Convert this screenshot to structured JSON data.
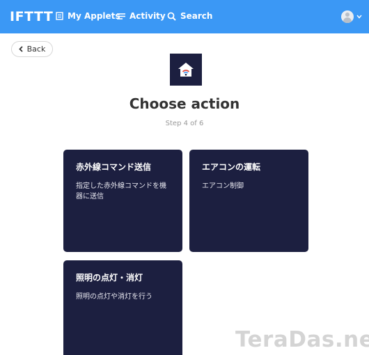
{
  "header": {
    "logo": "IFTTT",
    "nav": {
      "my_applets": "My Applets",
      "activity": "Activity",
      "search": "Search"
    },
    "brand_color": "#3b98f5"
  },
  "back": {
    "label": "Back"
  },
  "service": {
    "icon": "home-wifi-icon",
    "color": "#1c1f40"
  },
  "page": {
    "title": "Choose action",
    "step": "Step 4 of 6"
  },
  "actions": [
    {
      "title": "赤外線コマンド送信",
      "description": "指定した赤外線コマンドを機器に送信"
    },
    {
      "title": "エアコンの運転",
      "description": "エアコン制御"
    },
    {
      "title": "照明の点灯・消灯",
      "description": "照明の点灯や消灯を行う"
    }
  ],
  "watermark": "TeraDas.net"
}
